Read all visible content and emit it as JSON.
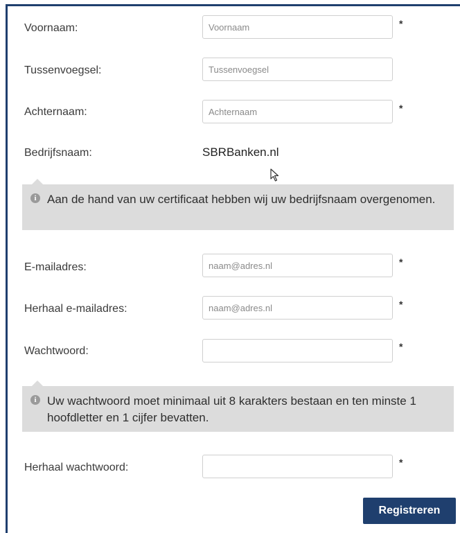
{
  "form": {
    "fields": [
      {
        "label": "Voornaam:",
        "placeholder": "Voornaam",
        "required_mark": "*"
      },
      {
        "label": "Tussenvoegsel:",
        "placeholder": "Tussenvoegsel",
        "required_mark": ""
      },
      {
        "label": "Achternaam:",
        "placeholder": "Achternaam",
        "required_mark": "*"
      },
      {
        "label": "E-mailadres:",
        "placeholder": "naam@adres.nl",
        "required_mark": "*"
      },
      {
        "label": "Herhaal e-mailadres:",
        "placeholder": "naam@adres.nl",
        "required_mark": "*"
      },
      {
        "label": "Wachtwoord:",
        "placeholder": "",
        "required_mark": "*"
      },
      {
        "label": "Herhaal wachtwoord:",
        "placeholder": "",
        "required_mark": "*"
      }
    ],
    "company": {
      "label": "Bedrijfsnaam:",
      "value": "SBRBanken.nl"
    },
    "info_company": "Aan de hand van uw certificaat hebben wij uw bedrijfsnaam overgenomen.",
    "info_password": "Uw wachtwoord moet minimaal uit 8 karakters bestaan en ten minste 1 hoofdletter en 1 cijfer bevatten.",
    "submit_label": "Registreren",
    "info_icon_glyph": "i"
  },
  "colors": {
    "accent": "#1f3f6e",
    "info_bg": "#dcdcdc"
  },
  "icons": {
    "info": "info-circle-icon",
    "cursor": "mouse-pointer-icon"
  }
}
